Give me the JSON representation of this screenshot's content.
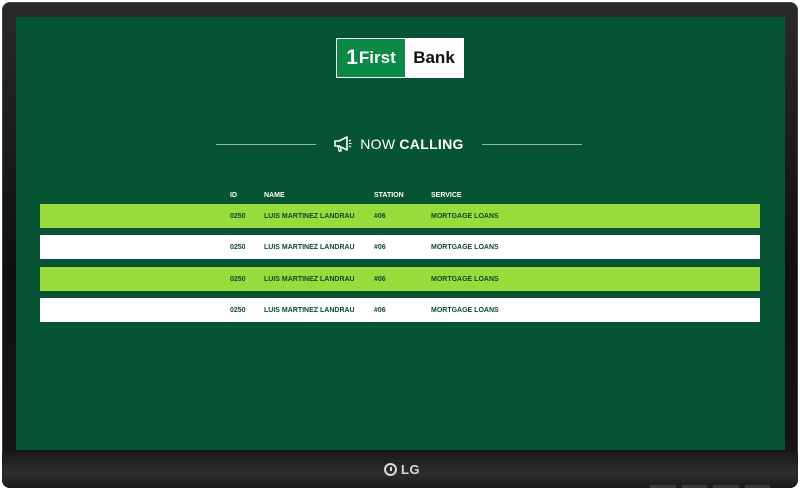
{
  "tv": {
    "brand": "LG"
  },
  "bank": {
    "logo_number": "1",
    "logo_left": "First",
    "logo_right": "Bank"
  },
  "heading": {
    "light": "NOW",
    "strong": "CALLING",
    "icon": "megaphone-icon"
  },
  "table": {
    "headers": {
      "id": "ID",
      "name": "NAME",
      "station": "STATION",
      "service": "SERVICE"
    },
    "rows": [
      {
        "id": "0250",
        "name": "LUIS MARTINEZ LANDRAU",
        "station": "#06",
        "service": "MORTGAGE LOANS"
      },
      {
        "id": "0250",
        "name": "LUIS MARTINEZ LANDRAU",
        "station": "#06",
        "service": "MORTGAGE LOANS"
      },
      {
        "id": "0250",
        "name": "LUIS MARTINEZ LANDRAU",
        "station": "#06",
        "service": "MORTGAGE LOANS"
      },
      {
        "id": "0250",
        "name": "LUIS MARTINEZ LANDRAU",
        "station": "#06",
        "service": "MORTGAGE LOANS"
      }
    ]
  },
  "colors": {
    "screen_bg": "#065434",
    "row_green": "#97dc3a",
    "row_white": "#ffffff",
    "brand_green": "#0b8a45"
  }
}
